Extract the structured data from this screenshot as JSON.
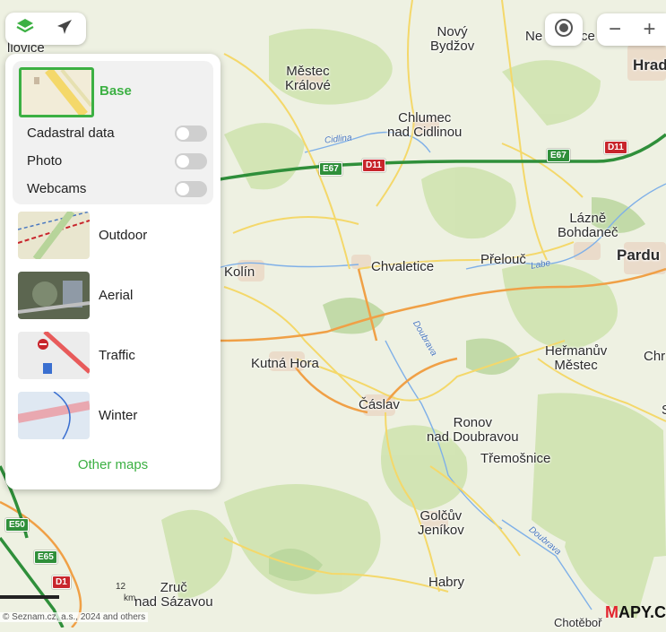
{
  "map": {
    "places": [
      {
        "name": "Nový\nBydžov",
        "cls": "p-md"
      },
      {
        "name": "Městec\nKrálové",
        "cls": "p-md"
      },
      {
        "name": "Chlumec\nnad Cidlinou",
        "cls": "p-md"
      },
      {
        "name": "Hrad",
        "cls": "p-lg"
      },
      {
        "name": "Lázně\nBohdaneč",
        "cls": "p-md"
      },
      {
        "name": "Pardu",
        "cls": "p-lg"
      },
      {
        "name": "Přelouč",
        "cls": "p-md"
      },
      {
        "name": "Chvaletice",
        "cls": "p-md"
      },
      {
        "name": "Kolín",
        "cls": "p-md"
      },
      {
        "name": "Kutná Hora",
        "cls": "p-md"
      },
      {
        "name": "Čáslav",
        "cls": "p-md"
      },
      {
        "name": "Heřmanův\nMěstec",
        "cls": "p-md"
      },
      {
        "name": "Chr",
        "cls": "p-md"
      },
      {
        "name": "Ronov\nnad Doubravou",
        "cls": "p-md"
      },
      {
        "name": "Třemošnice",
        "cls": "p-md"
      },
      {
        "name": "Golčův\nJeníkov",
        "cls": "p-md"
      },
      {
        "name": "Habry",
        "cls": "p-md"
      },
      {
        "name": "Zruč\nnad Sázavou",
        "cls": "p-md"
      },
      {
        "name": "Chotěboř",
        "cls": "p-sm"
      },
      {
        "name": "Ne",
        "cls": "p-md"
      },
      {
        "name": "ce",
        "cls": "p-md"
      },
      {
        "name": "llovice",
        "cls": "p-md"
      },
      {
        "name": "S",
        "cls": "p-md"
      }
    ],
    "rivers": [
      {
        "name": "Cidlina"
      },
      {
        "name": "Labe"
      },
      {
        "name": "Doubrava"
      },
      {
        "name": "Doubrava"
      }
    ],
    "shields": [
      {
        "text": "E67",
        "type": "e"
      },
      {
        "text": "D11",
        "type": "d"
      },
      {
        "text": "E67",
        "type": "e"
      },
      {
        "text": "D11",
        "type": "d"
      },
      {
        "text": "E50",
        "type": "e"
      },
      {
        "text": "E65",
        "type": "e"
      },
      {
        "text": "D1",
        "type": "d"
      },
      {
        "text": "12",
        "type": "plain"
      }
    ]
  },
  "top_left_controls": {
    "layers_icon": "layers-icon",
    "plane_icon": "airplane-icon"
  },
  "top_right_controls": {
    "locate_icon": "locate-icon",
    "zoom_out": "−",
    "zoom_in": "+"
  },
  "layer_panel": {
    "base": {
      "label": "Base"
    },
    "options": [
      {
        "label": "Cadastral data",
        "enabled": false
      },
      {
        "label": "Photo",
        "enabled": false
      },
      {
        "label": "Webcams",
        "enabled": false
      }
    ],
    "maps": [
      {
        "label": "Outdoor"
      },
      {
        "label": "Aerial"
      },
      {
        "label": "Traffic"
      },
      {
        "label": "Winter"
      }
    ],
    "other_maps": "Other maps"
  },
  "footer": {
    "attribution": "© Seznam.cz, a.s., 2024 and others",
    "scale": "km",
    "logo_m": "M",
    "logo_rest": "APY.C"
  }
}
